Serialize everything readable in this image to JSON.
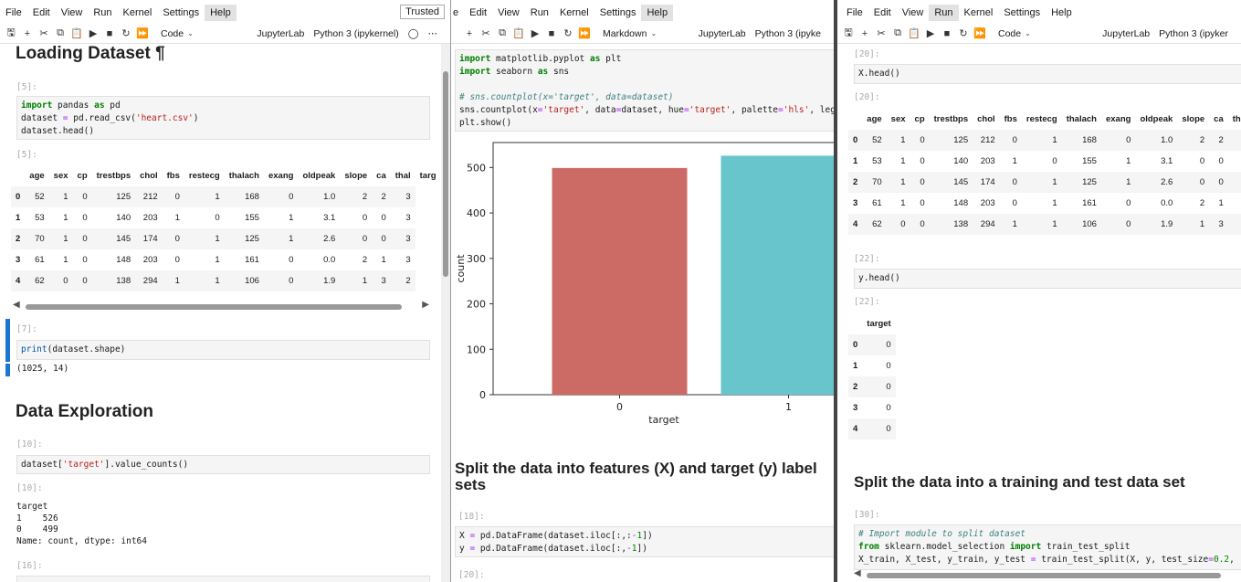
{
  "menus": {
    "file": "File",
    "edit": "Edit",
    "view": "View",
    "run": "Run",
    "kernel": "Kernel",
    "settings": "Settings",
    "help": "Help"
  },
  "w1": {
    "trusted": "Trusted",
    "cell_type": "Code",
    "app": "JupyterLab",
    "kernel": "Python 3 (ipykernel)",
    "heading_loading": "Loading Dataset ¶",
    "prompt5": "[5]:",
    "prompt5out": "[5]:",
    "prompt7": "[7]:",
    "shape_out": "(1025, 14)",
    "heading_explore": "Data Exploration",
    "prompt10": "[10]:",
    "prompt10out": "[10]:",
    "prompt16": "[16]:",
    "vc_out": "target\n1    526\n0    499\nName: count, dtype: int64"
  },
  "w2": {
    "cell_type": "Markdown",
    "app": "JupyterLab",
    "kernel": "Python 3 (ipyke",
    "heading_split": "Split the data into features (X) and target (y) label sets",
    "prompt18": "[18]:",
    "prompt20": "[20]:"
  },
  "w3": {
    "cell_type": "Code",
    "app": "JupyterLab",
    "kernel": "Python 3 (ipyker",
    "prompt20": "[20]:",
    "prompt20out": "[20]:",
    "xhead": "X.head()",
    "prompt22": "[22]:",
    "prompt22out": "[22]:",
    "yhead": "y.head()",
    "heading_split": "Split the data into a training and test data set",
    "prompt30": "[30]:"
  },
  "df": {
    "columns": [
      "age",
      "sex",
      "cp",
      "trestbps",
      "chol",
      "fbs",
      "restecg",
      "thalach",
      "exang",
      "oldpeak",
      "slope",
      "ca",
      "thal",
      "targ"
    ],
    "index": [
      "0",
      "1",
      "2",
      "3",
      "4"
    ],
    "rows": [
      [
        "52",
        "1",
        "0",
        "125",
        "212",
        "0",
        "1",
        "168",
        "0",
        "1.0",
        "2",
        "2",
        "3"
      ],
      [
        "53",
        "1",
        "0",
        "140",
        "203",
        "1",
        "0",
        "155",
        "1",
        "3.1",
        "0",
        "0",
        "3"
      ],
      [
        "70",
        "1",
        "0",
        "145",
        "174",
        "0",
        "1",
        "125",
        "1",
        "2.6",
        "0",
        "0",
        "3"
      ],
      [
        "61",
        "1",
        "0",
        "148",
        "203",
        "0",
        "1",
        "161",
        "0",
        "0.0",
        "2",
        "1",
        "3"
      ],
      [
        "62",
        "0",
        "0",
        "138",
        "294",
        "1",
        "1",
        "106",
        "0",
        "1.9",
        "1",
        "3",
        "2"
      ]
    ]
  },
  "xdf": {
    "columns": [
      "age",
      "sex",
      "cp",
      "trestbps",
      "chol",
      "fbs",
      "restecg",
      "thalach",
      "exang",
      "oldpeak",
      "slope",
      "ca",
      "tha"
    ],
    "rows": [
      [
        "52",
        "1",
        "0",
        "125",
        "212",
        "0",
        "1",
        "168",
        "0",
        "1.0",
        "2",
        "2",
        ""
      ],
      [
        "53",
        "1",
        "0",
        "140",
        "203",
        "1",
        "0",
        "155",
        "1",
        "3.1",
        "0",
        "0",
        ""
      ],
      [
        "70",
        "1",
        "0",
        "145",
        "174",
        "0",
        "1",
        "125",
        "1",
        "2.6",
        "0",
        "0",
        ""
      ],
      [
        "61",
        "1",
        "0",
        "148",
        "203",
        "0",
        "1",
        "161",
        "0",
        "0.0",
        "2",
        "1",
        ""
      ],
      [
        "62",
        "0",
        "0",
        "138",
        "294",
        "1",
        "1",
        "106",
        "0",
        "1.9",
        "1",
        "3",
        ""
      ]
    ]
  },
  "ydf": {
    "column": "target",
    "values": [
      "0",
      "0",
      "0",
      "0",
      "0"
    ]
  },
  "chart_data": {
    "type": "bar",
    "categories": [
      "0",
      "1"
    ],
    "values": [
      499,
      526
    ],
    "xlabel": "target",
    "ylabel": "count",
    "ylim": [
      0,
      555
    ],
    "yticks": [
      0,
      100,
      200,
      300,
      400,
      500
    ],
    "colors": [
      "#cc6b65",
      "#67c5cb"
    ]
  }
}
